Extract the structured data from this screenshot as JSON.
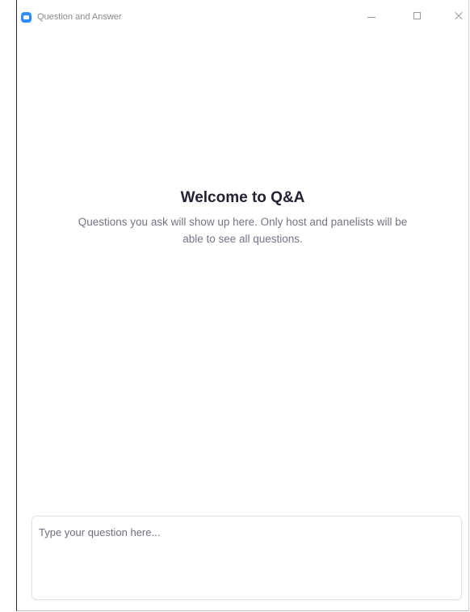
{
  "window": {
    "title": "Question and Answer",
    "brand_color": "#2D8CFF",
    "controls": [
      "minimize-icon",
      "maximize-icon",
      "close-icon"
    ]
  },
  "welcome": {
    "title": "Welcome to Q&A",
    "text": "Questions you ask will show up here. Only host and panelists will be able to see all questions."
  },
  "question_input": {
    "value": "",
    "placeholder": "Type your question here..."
  }
}
